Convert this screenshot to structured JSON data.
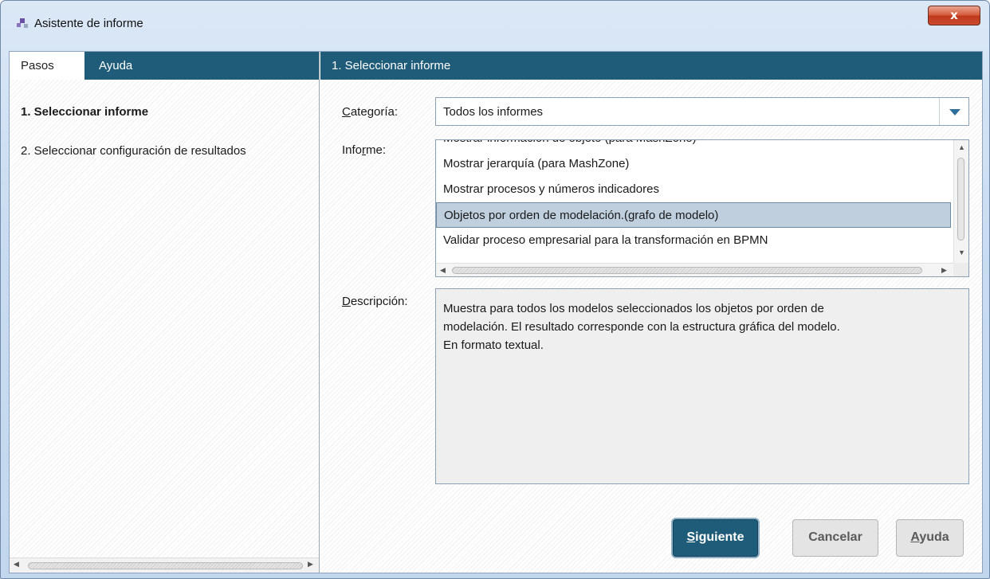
{
  "window": {
    "title": "Asistente de informe",
    "close_label": "x"
  },
  "left": {
    "tabs": [
      {
        "label": "Pasos",
        "active": true
      },
      {
        "label": "Ayuda",
        "active": false
      }
    ],
    "steps": [
      {
        "label": "1. Seleccionar informe",
        "active": true
      },
      {
        "label": "2. Seleccionar configuración de resultados",
        "active": false
      }
    ]
  },
  "right": {
    "header": "1. Seleccionar informe",
    "category": {
      "label_prefix": "",
      "label_mnemonic": "C",
      "label_rest": "ategoría:",
      "value": "Todos los informes"
    },
    "report": {
      "label_prefix": "Info",
      "label_mnemonic": "r",
      "label_rest": "me:",
      "items": [
        {
          "label": "Mostrar información de objeto (para MashZone)",
          "selected": false,
          "partial": true
        },
        {
          "label": "Mostrar jerarquía (para MashZone)",
          "selected": false
        },
        {
          "label": "Mostrar procesos y números indicadores",
          "selected": false
        },
        {
          "label": "Objetos por orden de modelación.(grafo de modelo)",
          "selected": true
        },
        {
          "label": "Validar proceso empresarial para la transformación en BPMN",
          "selected": false
        }
      ]
    },
    "description": {
      "label_prefix": "",
      "label_mnemonic": "D",
      "label_rest": "escripción:",
      "lines": [
        "Muestra para todos los modelos seleccionados los objetos por orden de",
        "modelación. El resultado corresponde con la estructura gráfica del modelo.",
        "En formato textual."
      ]
    }
  },
  "buttons": {
    "next": {
      "mnemonic": "S",
      "rest": "iguiente"
    },
    "cancel": {
      "label": "Cancelar"
    },
    "help": {
      "mnemonic": "A",
      "rest": "yuda"
    }
  },
  "colors": {
    "header_bg": "#1f5c7a",
    "selection_bg": "#bfcfdd",
    "close_button": "#c94b2e"
  }
}
